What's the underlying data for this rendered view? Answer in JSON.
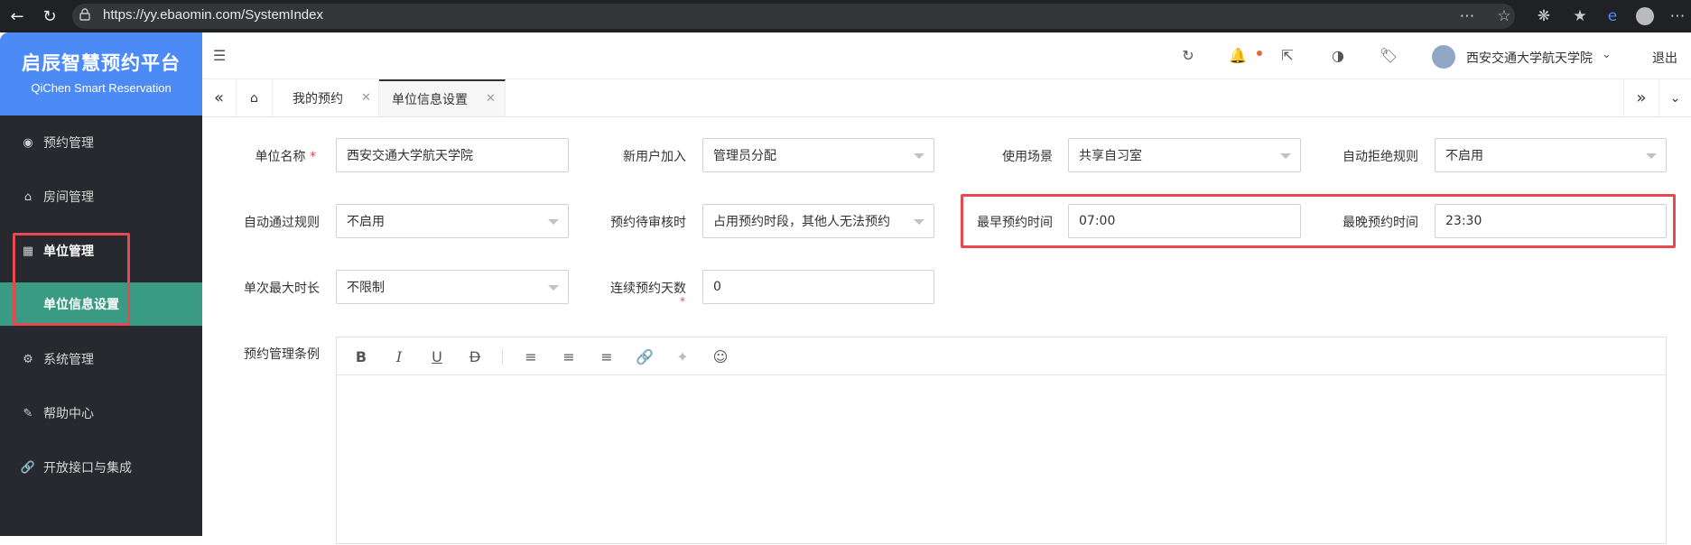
{
  "browser": {
    "url": "https://yy.ebaomin.com/SystemIndex"
  },
  "sidebar": {
    "brand_title": "启辰智慧预约平台",
    "brand_subtitle": "QiChen Smart Reservation",
    "items": [
      {
        "label": "预约管理",
        "icon": "eye-icon"
      },
      {
        "label": "房间管理",
        "icon": "home-icon"
      },
      {
        "label": "单位管理",
        "icon": "building-icon"
      },
      {
        "label": "单位信息设置",
        "icon": ""
      },
      {
        "label": "系统管理",
        "icon": "gear-icon"
      },
      {
        "label": "帮助中心",
        "icon": "help-icon"
      },
      {
        "label": "开放接口与集成",
        "icon": "link-icon"
      }
    ]
  },
  "topbar": {
    "user_name": "西安交通大学航天学院",
    "logout": "退出",
    "notification_dot_color": "#e8643c"
  },
  "tabs": [
    {
      "label": "我的预约"
    },
    {
      "label": "单位信息设置"
    }
  ],
  "form": {
    "unit_name_label": "单位名称",
    "unit_name_value": "西安交通大学航天学院",
    "new_user_label": "新用户加入",
    "new_user_value": "管理员分配",
    "scene_label": "使用场景",
    "scene_value": "共享自习室",
    "auto_reject_label": "自动拒绝规则",
    "auto_reject_value": "不启用",
    "auto_pass_label": "自动通过规则",
    "auto_pass_value": "不启用",
    "pending_label": "预约待审核时",
    "pending_value": "占用预约时段，其他人无法预约",
    "earliest_label": "最早预约时间",
    "earliest_value": "07:00",
    "latest_label": "最晚预约时间",
    "latest_value": "23:30",
    "max_duration_label": "单次最大时长",
    "max_duration_value": "不限制",
    "consecutive_days_label": "连续预约天数",
    "consecutive_days_value": "0",
    "rules_label": "预约管理条例"
  },
  "colors": {
    "brand": "#4c8bf5",
    "sidebar_bg": "#28292e",
    "active_submenu": "#3a9b85",
    "highlight": "#e8484f"
  }
}
